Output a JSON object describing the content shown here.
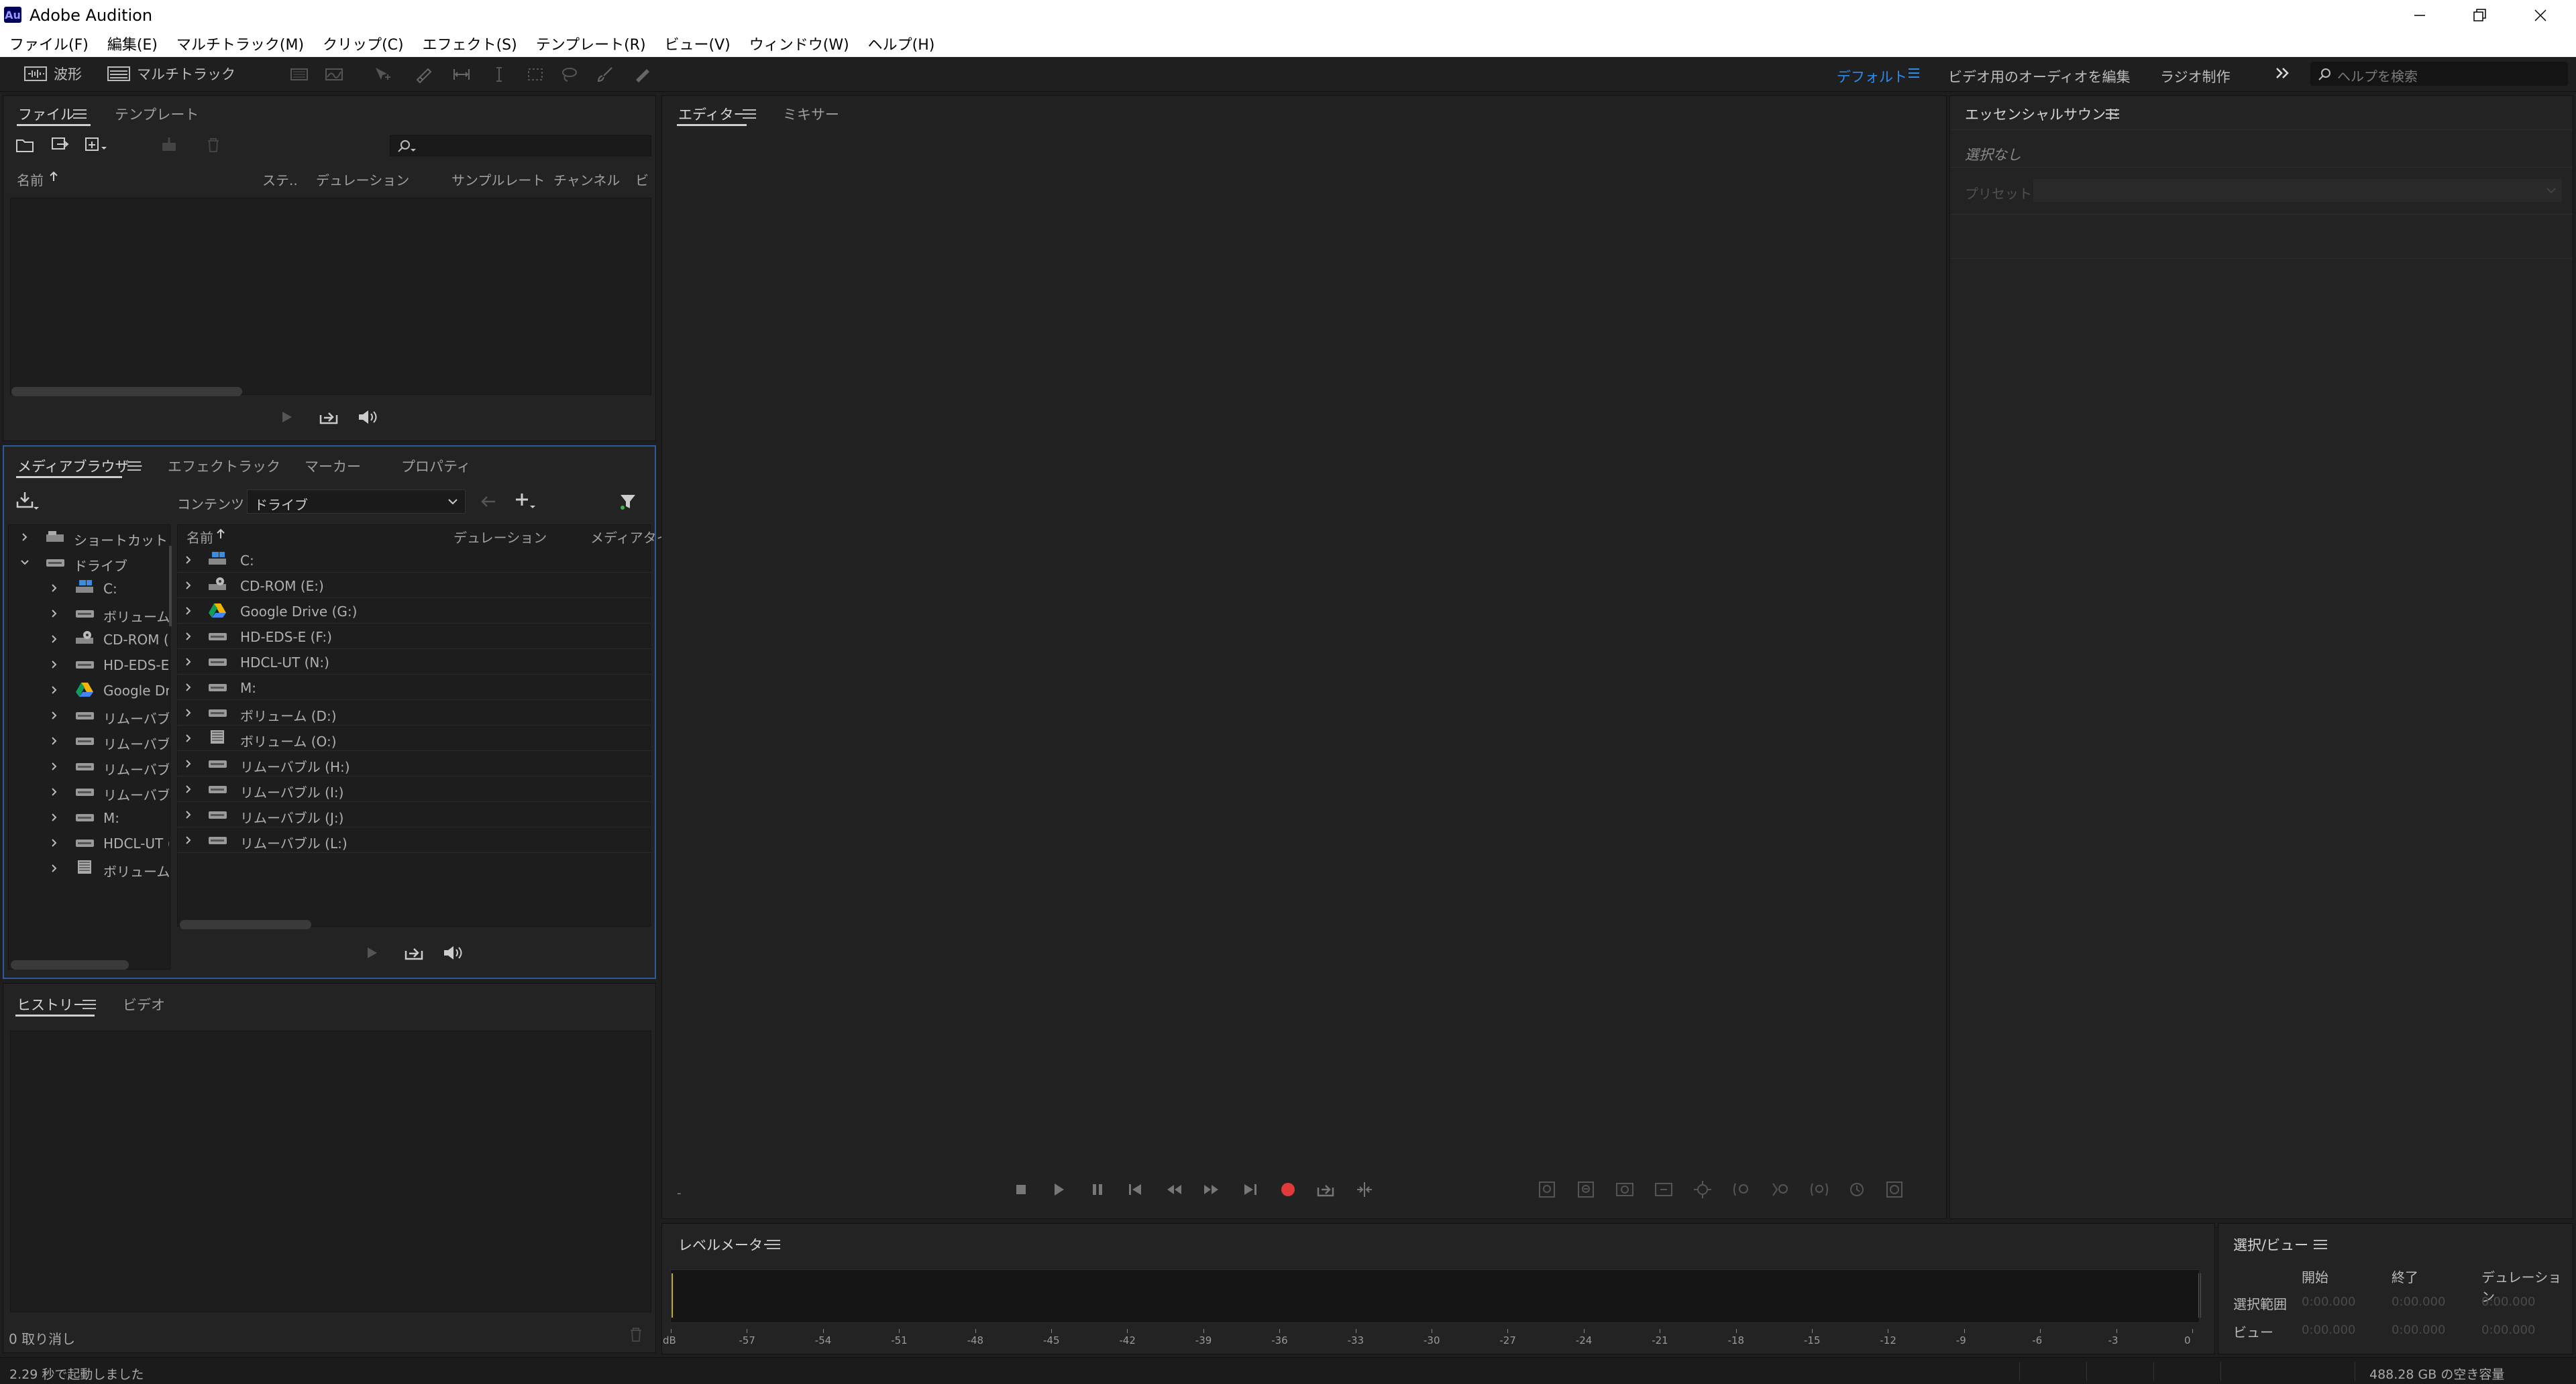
{
  "window": {
    "app_icon": "Au",
    "title": "Adobe Audition"
  },
  "menu": [
    "ファイル(F)",
    "編集(E)",
    "マルチトラック(M)",
    "クリップ(C)",
    "エフェクト(S)",
    "テンプレート(R)",
    "ビュー(V)",
    "ウィンドウ(W)",
    "ヘルプ(H)"
  ],
  "toolbar": {
    "waveform_label": "波形",
    "multitrack_label": "マルチトラック"
  },
  "workspaces": {
    "default": "デフォルト",
    "edit_audio_video": "ビデオ用のオーディオを編集",
    "radio": "ラジオ制作",
    "search_placeholder": "ヘルプを検索"
  },
  "files_panel": {
    "tabs": [
      "ファイル",
      "テンプレート"
    ],
    "columns": [
      "名前",
      "ステ..",
      "デュレーション",
      "サンプルレート",
      "チャンネル",
      "ビ"
    ]
  },
  "media_browser": {
    "tabs": [
      "メディアブラウザー",
      "エフェクトラック",
      "マーカー",
      "プロパティ"
    ],
    "contents_label": "コンテンツ :",
    "contents_value": "ドライブ",
    "tree": [
      {
        "label": "ショートカット",
        "icon": "shortcut-icon",
        "level": 0,
        "expanded": false
      },
      {
        "label": "ドライブ",
        "icon": "drive-icon",
        "level": 0,
        "expanded": true
      },
      {
        "label": "C:",
        "icon": "system-drive-icon",
        "level": 1
      },
      {
        "label": "ボリューム (",
        "icon": "drive-icon",
        "level": 1
      },
      {
        "label": "CD-ROM (",
        "icon": "cdrom-icon",
        "level": 1
      },
      {
        "label": "HD-EDS-E",
        "icon": "drive-icon",
        "level": 1
      },
      {
        "label": "Google Dr",
        "icon": "google-drive-icon",
        "level": 1
      },
      {
        "label": "リムーバブル",
        "icon": "drive-icon",
        "level": 1
      },
      {
        "label": "リムーバブル",
        "icon": "drive-icon",
        "level": 1
      },
      {
        "label": "リムーバブル",
        "icon": "drive-icon",
        "level": 1
      },
      {
        "label": "リムーバブル",
        "icon": "drive-icon",
        "level": 1
      },
      {
        "label": "M:",
        "icon": "drive-icon",
        "level": 1
      },
      {
        "label": "HDCL-UT (",
        "icon": "drive-icon",
        "level": 1
      },
      {
        "label": "ボリューム (",
        "icon": "volume-image-icon",
        "level": 1
      }
    ],
    "columns": [
      "名前",
      "デュレーション",
      "メディアタイ"
    ],
    "rows": [
      {
        "label": "C:",
        "icon": "system-drive-icon"
      },
      {
        "label": "CD-ROM (E:)",
        "icon": "cdrom-icon"
      },
      {
        "label": "Google Drive (G:)",
        "icon": "google-drive-icon"
      },
      {
        "label": "HD-EDS-E (F:)",
        "icon": "drive-icon"
      },
      {
        "label": "HDCL-UT (N:)",
        "icon": "drive-icon"
      },
      {
        "label": "M:",
        "icon": "drive-icon"
      },
      {
        "label": "ボリューム (D:)",
        "icon": "drive-icon"
      },
      {
        "label": "ボリューム (O:)",
        "icon": "volume-image-icon"
      },
      {
        "label": "リムーバブル (H:)",
        "icon": "drive-icon"
      },
      {
        "label": "リムーバブル (I:)",
        "icon": "drive-icon"
      },
      {
        "label": "リムーバブル (J:)",
        "icon": "drive-icon"
      },
      {
        "label": "リムーバブル (L:)",
        "icon": "drive-icon"
      }
    ]
  },
  "history_panel": {
    "tabs": [
      "ヒストリー",
      "ビデオ"
    ],
    "status": "0 取り消し"
  },
  "editor": {
    "tabs": [
      "エディター",
      "ミキサー"
    ],
    "bottom_left_glyph": "-"
  },
  "essential_sound": {
    "title": "エッセンシャルサウンド",
    "no_selection": "選択なし",
    "preset_label": "プリセット :"
  },
  "level_meter": {
    "title": "レベルメーター",
    "scale": [
      "dB",
      "-57",
      "-54",
      "-51",
      "-48",
      "-45",
      "-42",
      "-39",
      "-36",
      "-33",
      "-30",
      "-27",
      "-24",
      "-21",
      "-18",
      "-15",
      "-12",
      "-9",
      "-6",
      "-3",
      "0"
    ]
  },
  "selection_view": {
    "title": "選択/ビュー",
    "headers": [
      "開始",
      "終了",
      "デュレーション"
    ],
    "rows": [
      {
        "label": "選択範囲",
        "start": "0:00.000",
        "end": "0:00.000",
        "duration": "0:00.000"
      },
      {
        "label": "ビュー",
        "start": "0:00.000",
        "end": "0:00.000",
        "duration": "0:00.000"
      }
    ]
  },
  "statusbar": {
    "left": "2.29 秒で起動しました",
    "right": "488.28 GB の空き容量"
  },
  "colors": {
    "accent": "#2d8ceb",
    "record": "#e03a3a",
    "playhead": "#c8b400"
  }
}
